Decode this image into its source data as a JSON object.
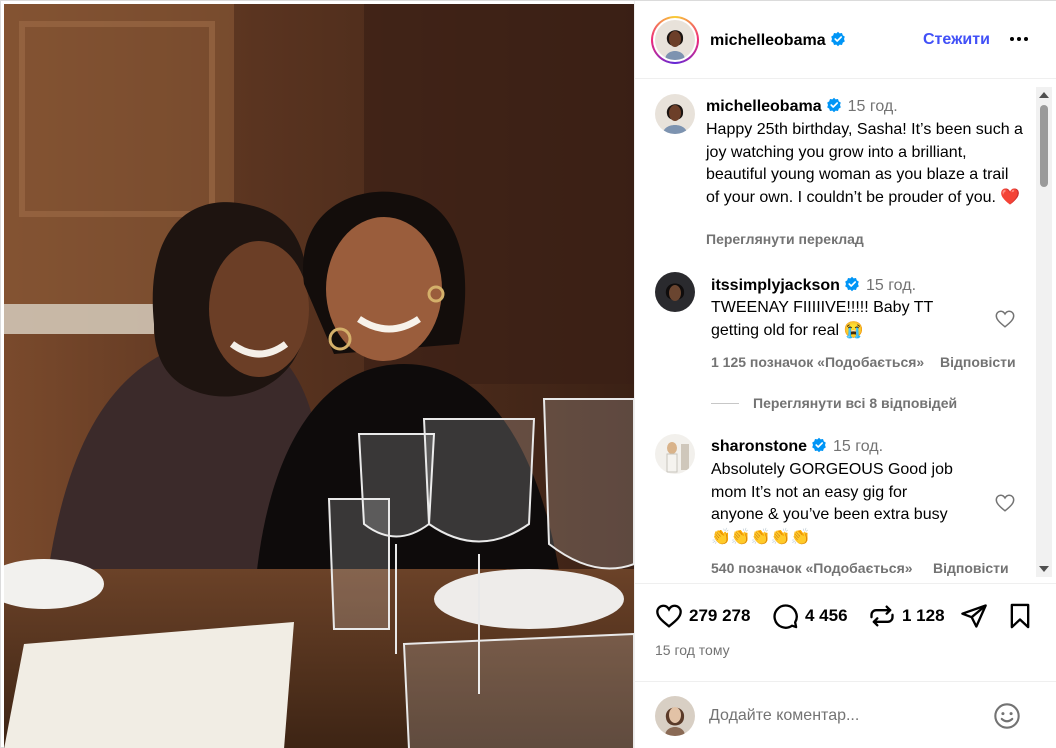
{
  "post": {
    "username": "michelleobama",
    "follow_label": "Стежити",
    "more_icon": "more-horizontal-icon",
    "verified_color": "#0095f6",
    "accent_color": "#4150f7"
  },
  "caption": {
    "username": "michelleobama",
    "time": "15 год.",
    "text": "Happy 25th birthday, Sasha! It’s been such a joy watching you grow into a brilliant, beautiful young woman as you blaze a trail of your own. I couldn’t be prouder of you.",
    "emoji": "❤️",
    "translate_label": "Переглянути переклад"
  },
  "comments": [
    {
      "username": "itssimplyjackson",
      "time": "15 год.",
      "text_line1": "TWEENAY FIIIIIVE!!!!! Baby TT",
      "text_line2": "getting old for real 😭",
      "likes_label": "1 125 позначок «Подобається»",
      "reply_label": "Відповісти"
    },
    {
      "username": "sharonstone",
      "time": "15 год.",
      "text_line1": "Absolutely GORGEOUS Good job",
      "text_line2": "mom It’s not an easy gig for",
      "text_line3": "anyone & you’ve been extra busy",
      "text_line4": "👏👏👏👏👏",
      "likes_label": "540 позначок «Подобається»",
      "reply_label": "Відповісти"
    }
  ],
  "view_replies_label": "Переглянути всі 8 відповідей",
  "actions": {
    "likes": "279 278",
    "comments": "4 456",
    "reposts": "1 128",
    "posted_ago": "15 год тому"
  },
  "add_comment": {
    "placeholder": "Додайте коментар..."
  }
}
